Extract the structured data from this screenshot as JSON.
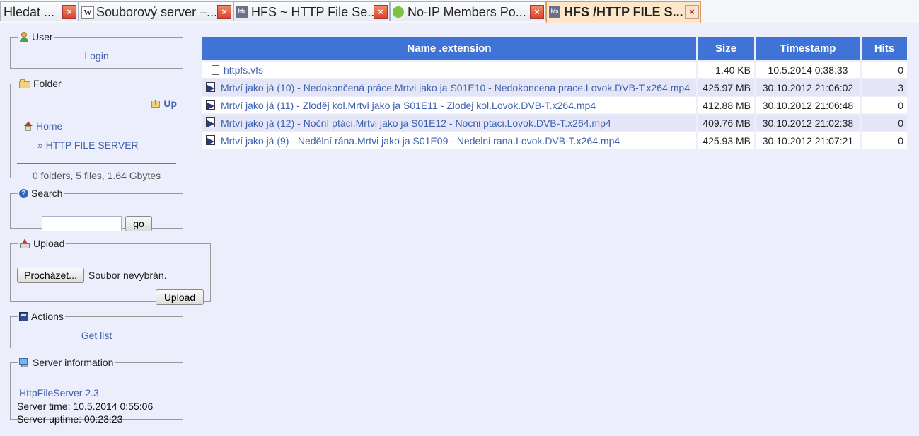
{
  "tabs": [
    {
      "title": "Hledat ...",
      "icon": "",
      "active": false
    },
    {
      "title": "Souborový server –...",
      "icon": "W",
      "active": false
    },
    {
      "title": "HFS ~ HTTP File Se...",
      "icon": "hfs",
      "active": false
    },
    {
      "title": "No-IP Members Po...",
      "icon": "noip",
      "active": false
    },
    {
      "title": "HFS /HTTP FILE S...",
      "icon": "hfs",
      "active": true
    }
  ],
  "tab_close_glyph": "×",
  "user": {
    "legend": "User",
    "login": "Login"
  },
  "folder": {
    "legend": "Folder",
    "up": "Up",
    "home": "Home",
    "current": "» HTTP FILE SERVER",
    "summary": "0 folders, 5 files, 1.64 Gbytes"
  },
  "search": {
    "legend": "Search",
    "value": "",
    "button": "go"
  },
  "upload": {
    "legend": "Upload",
    "browse": "Procházet...",
    "status": "Soubor nevybrán.",
    "button": "Upload"
  },
  "actions": {
    "legend": "Actions",
    "get_list": "Get list"
  },
  "server": {
    "legend": "Server information",
    "version": "HttpFileServer 2.3",
    "time": "Server time: 10.5.2014 0:55:06",
    "uptime": "Server uptime: 00:23:23"
  },
  "table": {
    "headers": {
      "name": "Name .extension",
      "size": "Size",
      "timestamp": "Timestamp",
      "hits": "Hits"
    },
    "rows": [
      {
        "icon": "doc",
        "name": "httpfs.vfs",
        "size": "1.40 KB",
        "timestamp": "10.5.2014 0:38:33",
        "hits": "0"
      },
      {
        "icon": "video",
        "name": "Mrtví jako já (10) - Nedokončená práce.Mrtvi jako ja S01E10 - Nedokoncena prace.Lovok.DVB-T.x264.mp4",
        "size": "425.97 MB",
        "timestamp": "30.10.2012 21:06:02",
        "hits": "3"
      },
      {
        "icon": "video",
        "name": "Mrtví jako já (11) - Zloděj kol.Mrtvi jako ja S01E11 - Zlodej kol.Lovok.DVB-T.x264.mp4",
        "size": "412.88 MB",
        "timestamp": "30.10.2012 21:06:48",
        "hits": "0"
      },
      {
        "icon": "video",
        "name": "Mrtví jako já (12) - Noční ptáci.Mrtvi jako ja S01E12 - Nocni ptaci.Lovok.DVB-T.x264.mp4",
        "size": "409.76 MB",
        "timestamp": "30.10.2012 21:02:38",
        "hits": "0"
      },
      {
        "icon": "video",
        "name": "Mrtví jako já (9) - Nedělní rána.Mrtvi jako ja S01E09 - Nedelni rana.Lovok.DVB-T.x264.mp4",
        "size": "425.93 MB",
        "timestamp": "30.10.2012 21:07:21",
        "hits": "0"
      }
    ]
  },
  "colors": {
    "header_bg": "#3f73d5",
    "link": "#3f62ad",
    "page_bg": "#edeefb",
    "row_alt": "#e4e6f7"
  }
}
